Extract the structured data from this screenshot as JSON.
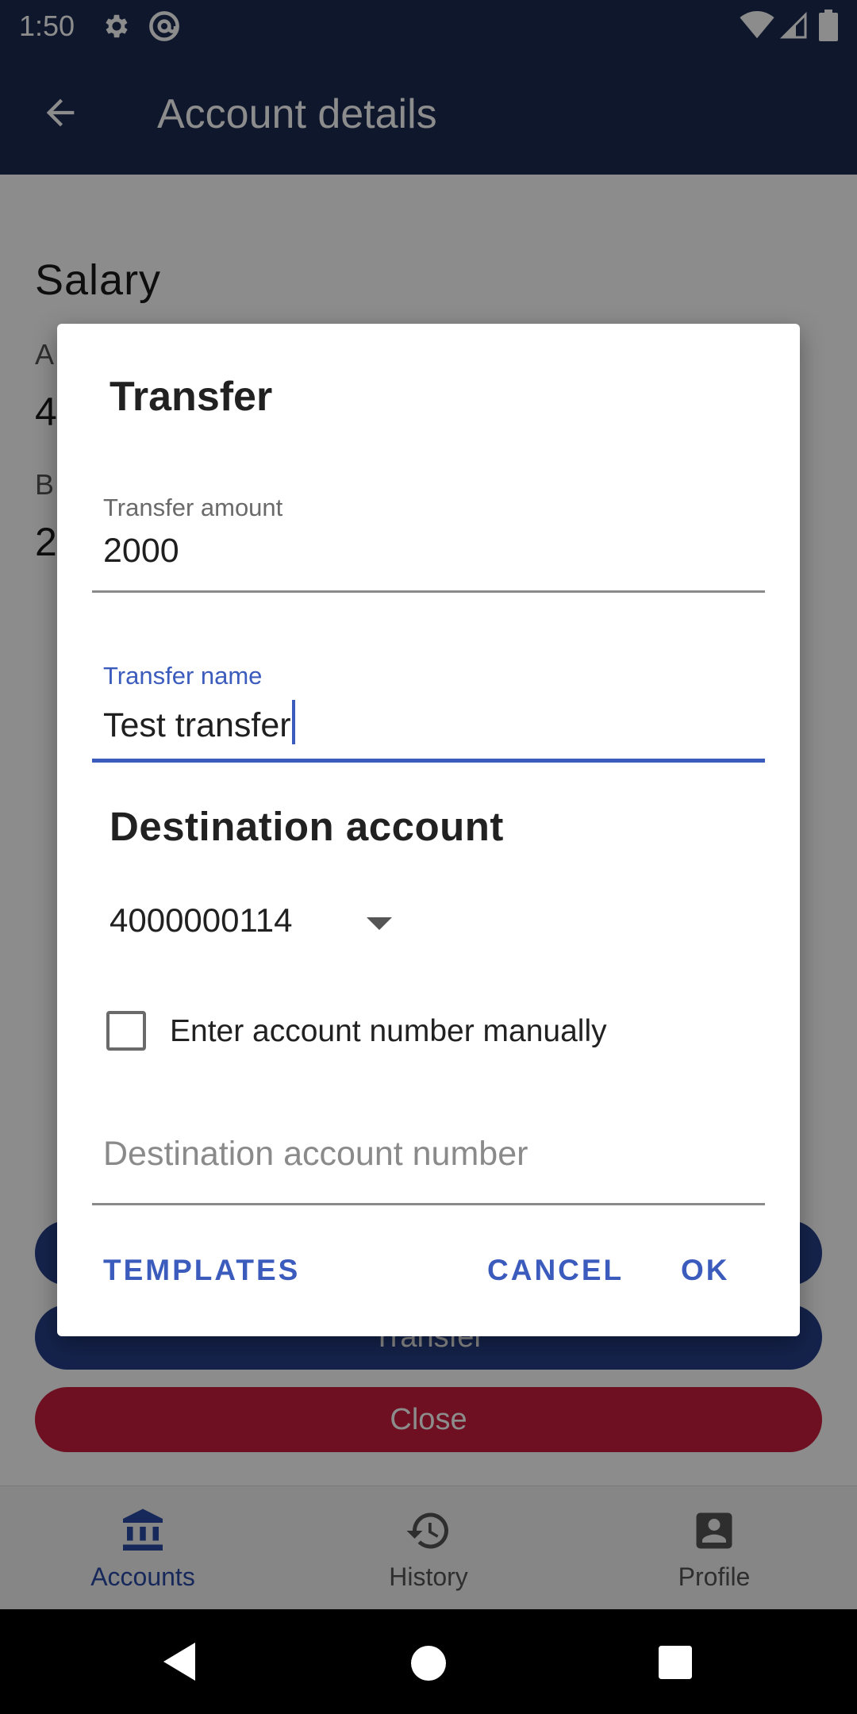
{
  "status_bar": {
    "time": "1:50"
  },
  "app_bar": {
    "title": "Account details"
  },
  "account": {
    "name": "Salary",
    "peek_label_a": "A",
    "peek_value_a": "4",
    "peek_label_b": "B",
    "peek_value_b": "2"
  },
  "buttons_behind": {
    "transfer": "Transfer",
    "close": "Close"
  },
  "bottom_nav": {
    "items": [
      {
        "label": "Accounts",
        "icon": "bank-icon",
        "selected": true
      },
      {
        "label": "History",
        "icon": "history-icon",
        "selected": false
      },
      {
        "label": "Profile",
        "icon": "profile-icon",
        "selected": false
      }
    ]
  },
  "dialog": {
    "title": "Transfer",
    "amount": {
      "label": "Transfer amount",
      "value": "2000"
    },
    "name": {
      "label": "Transfer name",
      "value": "Test transfer"
    },
    "destination_heading": "Destination account",
    "destination_selected": "4000000114",
    "manual_checkbox": {
      "label": "Enter account number manually",
      "checked": false
    },
    "destination_number": {
      "placeholder": "Destination account number",
      "value": ""
    },
    "actions": {
      "templates": "TEMPLATES",
      "cancel": "CANCEL",
      "ok": "OK"
    }
  },
  "colors": {
    "primary": "#1c2b52",
    "accent": "#3b5bbd",
    "danger": "#c81e3c"
  }
}
